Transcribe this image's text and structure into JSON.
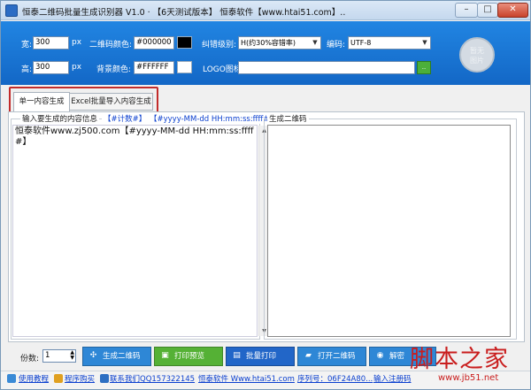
{
  "window": {
    "title": "恒泰二维码批量生成识别器 V1.0 · 【6天测试版本】 恒泰软件【www.htai51.com】.."
  },
  "settings": {
    "width_label": "宽:",
    "width_value": "300",
    "width_unit": "px",
    "height_label": "高:",
    "height_value": "300",
    "height_unit": "px",
    "qr_color_label": "二维码颜色:",
    "qr_color_value": "#000000",
    "qr_color_hex": "#000000",
    "bg_color_label": "背景颜色:",
    "bg_color_value": "#FFFFFF",
    "bg_color_hex": "#FFFFFF",
    "ecc_label": "纠错级别:",
    "ecc_value": "H(约30%容错率)",
    "encoding_label": "编码:",
    "encoding_value": "UTF-8",
    "logo_label": "LOGO图标:",
    "logo_value": "",
    "logo_preview_text": "暂无\n图片"
  },
  "tabs": [
    {
      "label": "单一内容生成"
    },
    {
      "label": "Excel批量导入内容生成"
    }
  ],
  "input_group": {
    "title": "输入要生成的内容信息",
    "link_counter": "【#计数#】",
    "link_datetime": "【#yyyy-MM-dd HH:mm:ss:ffff#】",
    "content": "恒泰软件www.zj500.com【#yyyy-MM-dd HH:mm:ss:ffff#】"
  },
  "output_group": {
    "title": "生成二维码"
  },
  "bottom": {
    "copies_label": "份数:",
    "copies_value": "1",
    "buttons": [
      {
        "label": "生成二维码",
        "color": "#2e87d6",
        "icon": "✣"
      },
      {
        "label": "打印预览",
        "color": "#55b135",
        "icon": "▣"
      },
      {
        "label": "批量打印",
        "color": "#2266c8",
        "icon": "▤"
      },
      {
        "label": "打开二维码",
        "color": "#2e87d6",
        "icon": "▰"
      },
      {
        "label": "解密",
        "color": "#2e87d6",
        "icon": "◉"
      }
    ]
  },
  "status": {
    "tutorial": "使用教程",
    "buy": "程序购买",
    "contact": "联系我们QQ157322145",
    "site": "恒泰软件 Www.htai51.com",
    "serial": "序列号：06F24A80...",
    "register": "输入注册码"
  },
  "watermark": {
    "title": "脚本之家",
    "url": "www.jb51.net"
  }
}
